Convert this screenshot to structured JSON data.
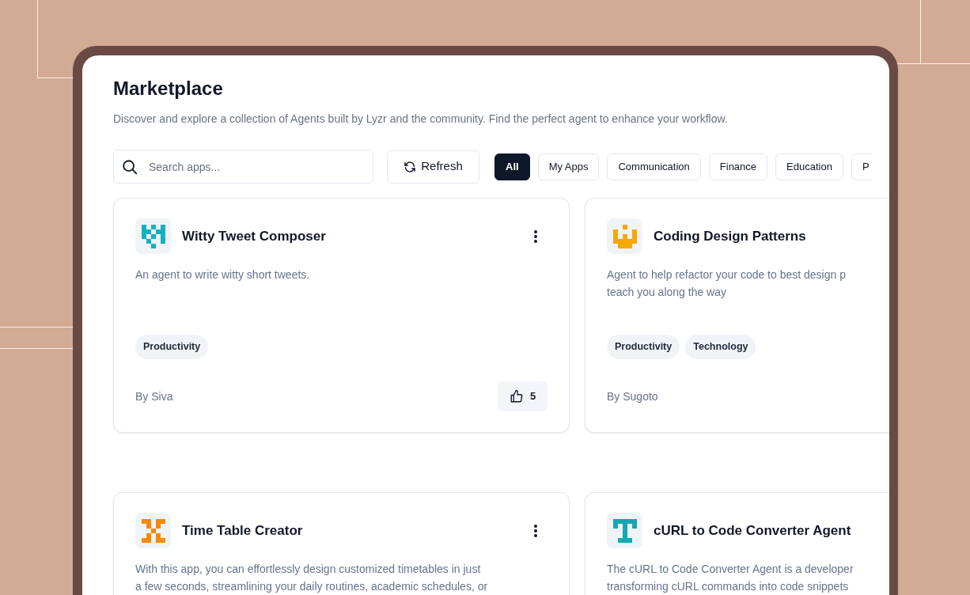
{
  "page": {
    "title": "Marketplace",
    "subtitle": "Discover and explore a collection of Agents built by Lyzr and the community. Find the perfect agent to enhance your workflow."
  },
  "search": {
    "placeholder": "Search apps..."
  },
  "refresh_button": {
    "label": "Refresh"
  },
  "filters": [
    {
      "label": "All",
      "selected": true
    },
    {
      "label": "My Apps",
      "selected": false
    },
    {
      "label": "Communication",
      "selected": false
    },
    {
      "label": "Finance",
      "selected": false
    },
    {
      "label": "Education",
      "selected": false
    },
    {
      "label": "P",
      "selected": false
    }
  ],
  "cards": [
    {
      "title": "Witty Tweet Composer",
      "color": "#14b1c4",
      "description_lines": [
        "An agent to write witty short tweets."
      ],
      "tags": [
        "Productivity"
      ],
      "author": "By Siva",
      "likes": "5"
    },
    {
      "title": "Coding Design Patterns",
      "color": "#f5a800",
      "description_lines": [
        "Agent to help refactor your code to best design p",
        "teach you along the way"
      ],
      "tags": [
        "Productivity",
        "Technology"
      ],
      "author": "By Sugoto"
    },
    {
      "title": "Time Table Creator",
      "color": "#f58a07",
      "description_lines": [
        "With this app, you can effortlessly design customized timetables in just",
        "a few seconds, streamlining your daily routines, academic schedules, or"
      ]
    },
    {
      "title": "cURL to Code Converter Agent",
      "color": "#14a8b4",
      "description_lines": [
        "The cURL to Code Converter Agent is a developer",
        "transforming cURL commands into code snippets"
      ]
    }
  ]
}
